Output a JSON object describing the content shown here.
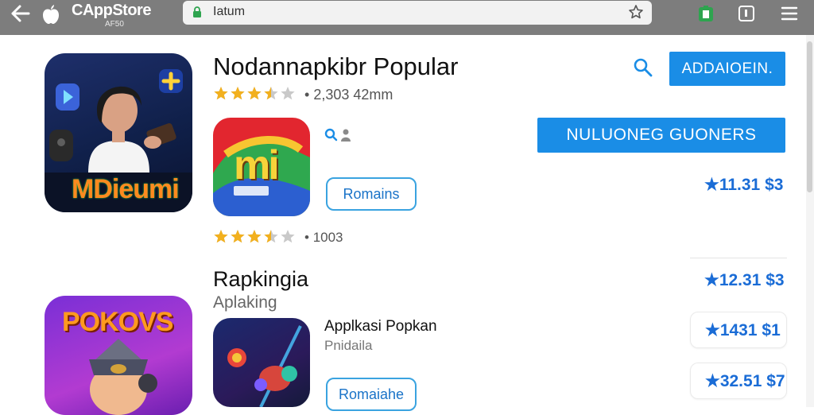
{
  "browser": {
    "brand": "AppStore",
    "brand_sub": "AF50",
    "url": "Iatum"
  },
  "featured": {
    "title": "Nodannapkibr Popular",
    "rating_meta": "2,303 42mm",
    "rating": 3.5,
    "icon_text": "MDieumi",
    "action_button": "ADDAIOEIN.",
    "wide_button": "NULUONEG GUONERS",
    "price": "11.31",
    "price_suffix": "$3"
  },
  "item_one": {
    "icon_text": "mi",
    "button": "Romains",
    "rating": 3.5,
    "rating_meta": "1003"
  },
  "section": {
    "title": "Rapkingia",
    "subtitle": "Aplaking",
    "price": "12.31",
    "price_suffix": "$3"
  },
  "item_two": {
    "title": "Applkasi Popkan",
    "subtitle": "Pnidaila",
    "button": "Romaiahe",
    "icon_text": "POKOVS",
    "price_a": "1431",
    "price_a_suffix": "$1",
    "price_b": "32.51",
    "price_b_suffix": "$7"
  },
  "colors": {
    "accent": "#1a8de6",
    "star": "#f2b01e",
    "price": "#1a6cd6",
    "topbar": "#7d7d7d"
  }
}
